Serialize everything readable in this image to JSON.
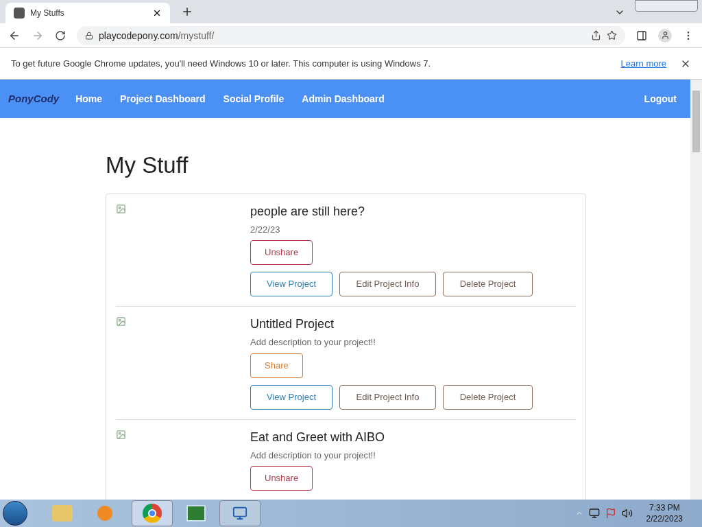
{
  "browser": {
    "tab_title": "My Stuffs",
    "url_host": "playcodepony.com",
    "url_path": "/mystuff/"
  },
  "infobar": {
    "message": "To get future Google Chrome updates, you'll need Windows 10 or later. This computer is using Windows 7.",
    "link": "Learn more"
  },
  "navbar": {
    "logo": "PonyCody",
    "items": [
      "Home",
      "Project Dashboard",
      "Social Profile",
      "Admin Dashboard"
    ],
    "logout": "Logout"
  },
  "page": {
    "title": "My Stuff"
  },
  "projects": [
    {
      "title": "people are still here?",
      "subtitle": "2/22/23",
      "share": {
        "label": "Unshare",
        "kind": "unshare"
      },
      "actions": [
        {
          "label": "View Project",
          "kind": "view"
        },
        {
          "label": "Edit Project Info",
          "kind": "edit"
        },
        {
          "label": "Delete Project",
          "kind": "delete"
        }
      ]
    },
    {
      "title": "Untitled Project",
      "subtitle": "Add description to your project!!",
      "share": {
        "label": "Share",
        "kind": "share"
      },
      "actions": [
        {
          "label": "View Project",
          "kind": "view"
        },
        {
          "label": "Edit Project Info",
          "kind": "edit"
        },
        {
          "label": "Delete Project",
          "kind": "delete"
        }
      ]
    },
    {
      "title": "Eat and Greet with AIBO",
      "subtitle": "Add description to your project!!",
      "share": {
        "label": "Unshare",
        "kind": "unshare"
      }
    }
  ],
  "taskbar": {
    "time": "7:33 PM",
    "date": "2/22/2023"
  }
}
